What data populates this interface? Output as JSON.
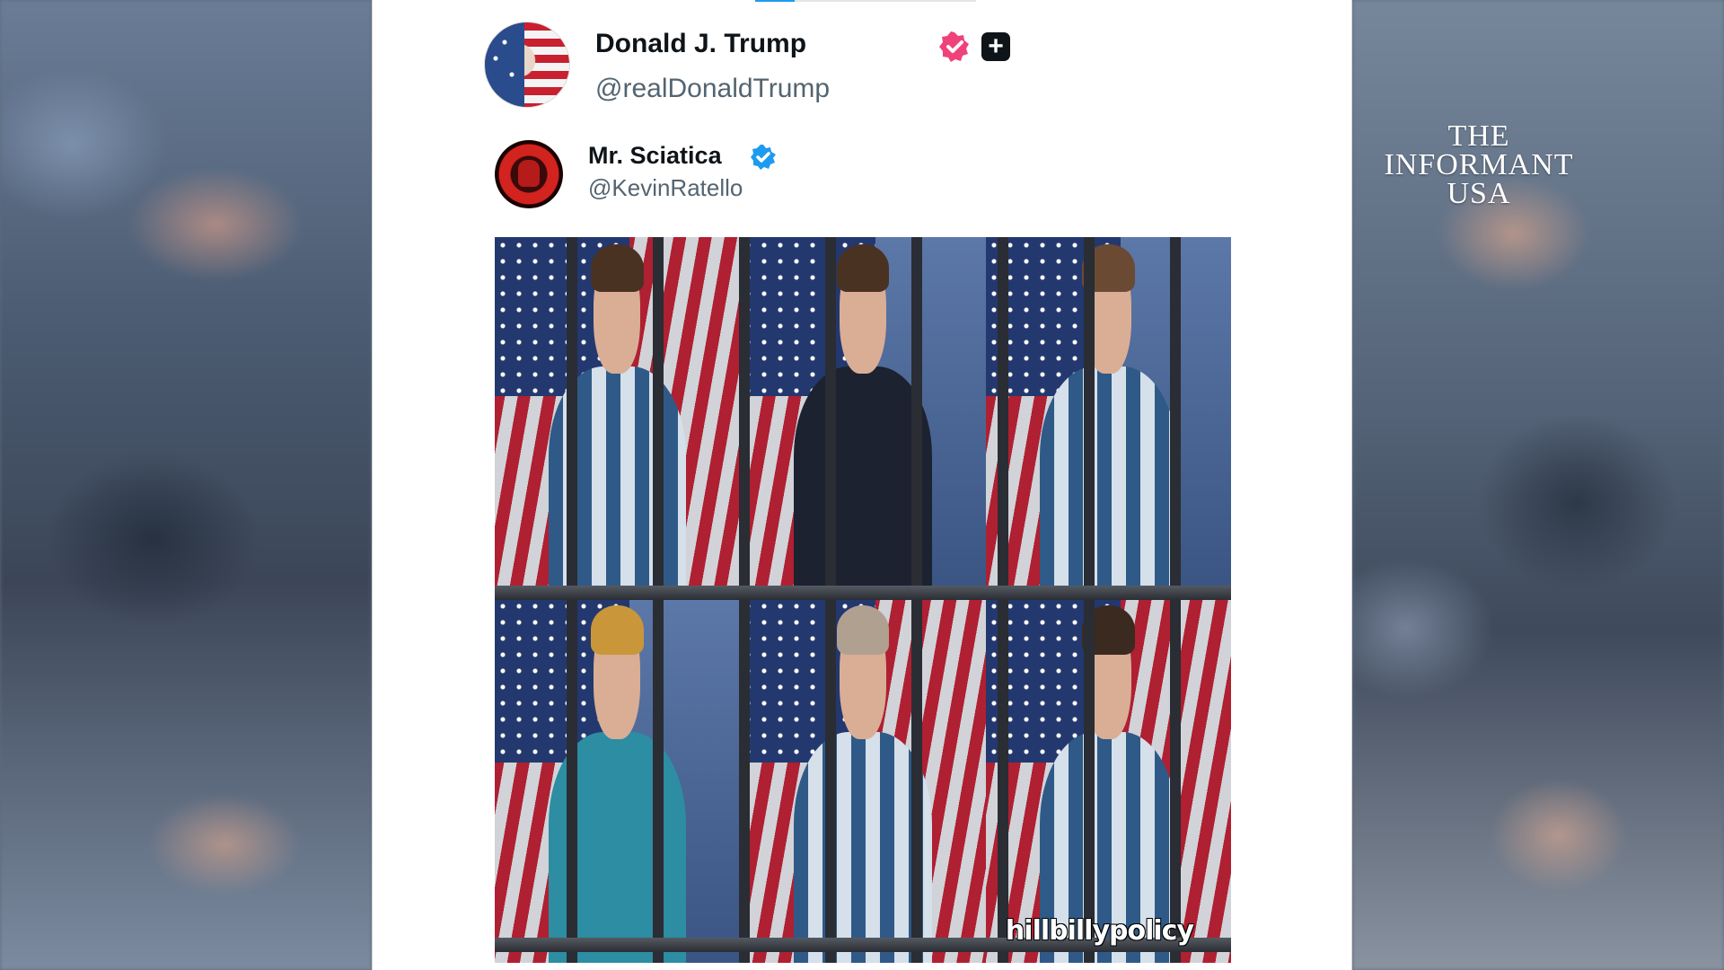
{
  "post": {
    "author_name": "Donald J. Trump",
    "author_handle": "@realDonaldTrump",
    "verified_badge_color": "#f0427a",
    "plus_badge": "+"
  },
  "quoted_post": {
    "author_name": "Mr. Sciatica",
    "author_handle": "@KevinRatello",
    "verified_badge_color": "#1d9bf0",
    "media_credit": "hillbillypolicy"
  },
  "watermark": {
    "line1": "THE",
    "line2": "INFORMANT",
    "line3": "USA"
  },
  "progress": {
    "fraction": 0.18
  },
  "icons": [
    "verified-pink-icon",
    "plus-icon",
    "verified-blue-icon"
  ]
}
